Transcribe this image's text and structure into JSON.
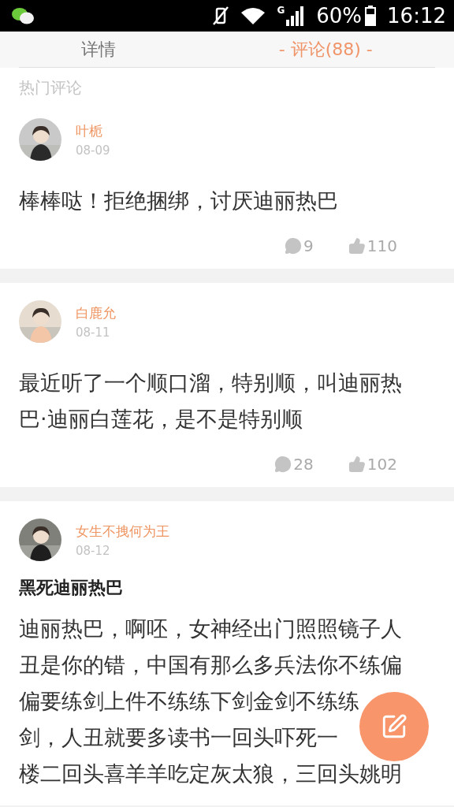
{
  "status_bar": {
    "network": "G",
    "battery": "60%",
    "time": "16:12"
  },
  "tabs": [
    {
      "label": "详情",
      "selected": false
    },
    {
      "label": "- 评论(88) -",
      "selected": true
    }
  ],
  "section_title": "热门评论",
  "comments": [
    {
      "user": "叶栀",
      "date": "08-09",
      "lines": [
        "棒棒哒！拒绝捆绑，讨厌迪丽热巴"
      ],
      "replies": "9",
      "likes": "110"
    },
    {
      "user": "白鹿允",
      "date": "08-11",
      "lines": [
        "最近听了一个顺口溜，特别顺，叫迪丽热",
        "巴·迪丽白莲花，是不是特别顺"
      ],
      "replies": "28",
      "likes": "102"
    },
    {
      "user": "女生不拽何为王",
      "date": "08-12",
      "title": "黑死迪丽热巴",
      "lines": [
        "迪丽热巴，啊呸，女神经出门照照镜子人",
        "丑是你的错，中国有那么多兵法你不练偏",
        "偏要练剑上件不练练下剑金剑不练练",
        "剑，人丑就要多读书一回头吓死一",
        "楼二回头喜羊羊吃定灰太狼，三回头姚明"
      ]
    }
  ]
}
